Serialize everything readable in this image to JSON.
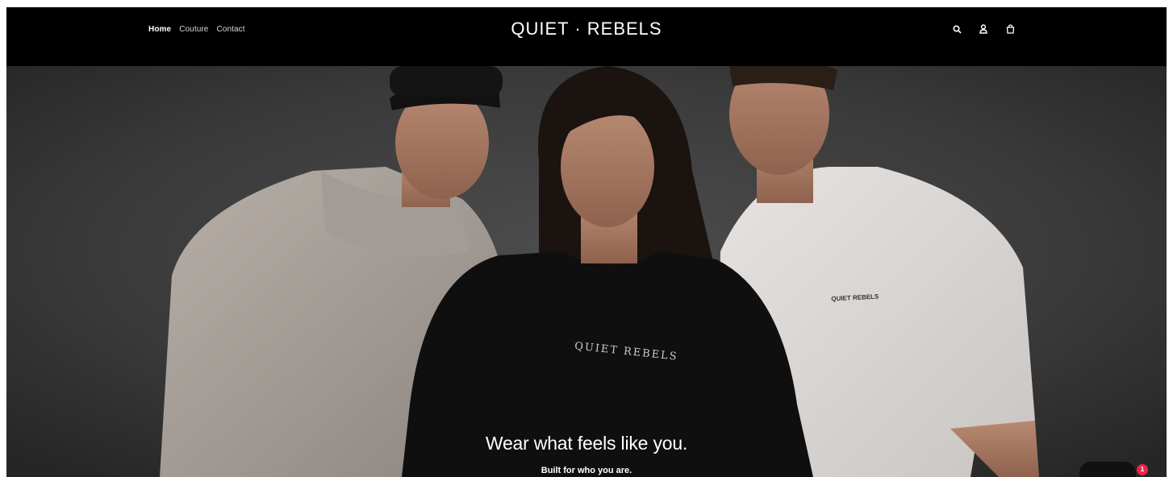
{
  "header": {
    "nav": [
      {
        "label": "Home",
        "active": true
      },
      {
        "label": "Couture",
        "active": false
      },
      {
        "label": "Contact",
        "active": false
      }
    ],
    "logo": "QUIET · REBELS",
    "icons": [
      "search-icon",
      "account-icon",
      "cart-icon"
    ]
  },
  "hero": {
    "headline": "Wear what feels like you.",
    "subline": "Built for who you are.",
    "shirt_print_center": "QUIET REBELS",
    "shirt_print_right": "QUIET REBELS"
  },
  "chat": {
    "badge_count": "1"
  },
  "colors": {
    "header_bg": "#000000",
    "badge": "#e8254a",
    "background_wall": "#3a3a3a"
  }
}
